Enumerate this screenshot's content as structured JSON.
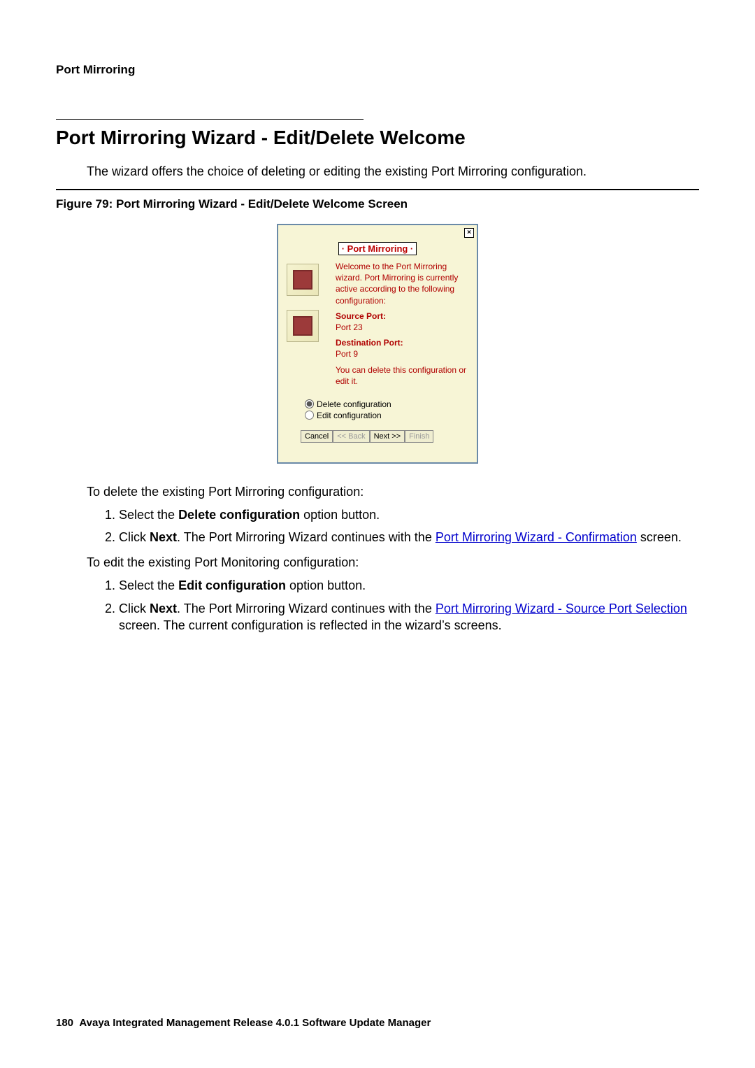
{
  "header": {
    "label": "Port Mirroring"
  },
  "section": {
    "title": "Port Mirroring Wizard - Edit/Delete Welcome",
    "intro": "The wizard offers the choice of deleting or editing the existing Port Mirroring configuration."
  },
  "figure": {
    "caption": "Figure 79: Port Mirroring Wizard - Edit/Delete Welcome Screen"
  },
  "wizard": {
    "close": "×",
    "title": "· Port Mirroring ·",
    "welcome_text": "Welcome to the Port Mirroring wizard. Port Mirroring is currently active according to the following configuration:",
    "source_label": "Source Port:",
    "source_value": "Port 23",
    "dest_label": "Destination Port:",
    "dest_value": "Port 9",
    "footer_text": "You can delete this configuration or edit it.",
    "option_delete": "Delete configuration",
    "option_edit": "Edit configuration",
    "btn_cancel": "Cancel",
    "btn_back": "<< Back",
    "btn_next": "Next >>",
    "btn_finish": "Finish"
  },
  "delete": {
    "intro": "To delete the existing Port Mirroring configuration:",
    "step1_a": "Select the ",
    "step1_b": "Delete configuration",
    "step1_c": " option button.",
    "step2_a": "Click ",
    "step2_b": "Next",
    "step2_c": ". The Port Mirroring Wizard continues with the ",
    "step2_link": "Port Mirroring Wizard - Confirmation",
    "step2_d": " screen."
  },
  "edit": {
    "intro": "To edit the existing Port Monitoring configuration:",
    "step1_a": "Select the ",
    "step1_b": "Edit configuration",
    "step1_c": " option button.",
    "step2_a": "Click ",
    "step2_b": "Next",
    "step2_c": ". The Port Mirroring Wizard continues with the ",
    "step2_link": "Port Mirroring Wizard - Source Port Selection",
    "step2_d": " screen. The current configuration is reflected in the wizard’s screens."
  },
  "footer": {
    "page": "180",
    "text": "Avaya Integrated Management Release 4.0.1 Software Update Manager"
  }
}
